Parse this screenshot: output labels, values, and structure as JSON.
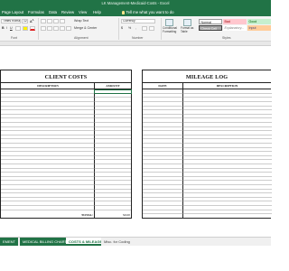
{
  "window": {
    "title": "LK Management-Medicaid-Costs  -  Excel"
  },
  "ribbon_tabs": [
    "Page Layout",
    "Formulas",
    "Data",
    "Review",
    "View",
    "Help"
  ],
  "tell_me": "Tell me what you want to do",
  "ribbon": {
    "font_name": "Times Roman",
    "font_size": "12",
    "wrap_text": "Wrap Text",
    "merge_center": "Merge & Center",
    "number_format": "Currency",
    "conditional_formatting": "Conditional Formatting",
    "format_as_table": "Format as Table",
    "groups": {
      "font": "Font",
      "alignment": "Alignment",
      "number": "Number",
      "styles": "Styles"
    },
    "styles": [
      {
        "name": "Normal",
        "bg": "#ffffff",
        "fg": "#222222"
      },
      {
        "name": "Bad",
        "bg": "#ffc7ce",
        "fg": "#9c0006"
      },
      {
        "name": "Good",
        "bg": "#c6efce",
        "fg": "#006100"
      },
      {
        "name": "Check Cell",
        "bg": "#a5a5a5",
        "fg": "#ffffff"
      },
      {
        "name": "Explanatory...",
        "bg": "#ffffff",
        "fg": "#7f7f7f"
      },
      {
        "name": "Input",
        "bg": "#ffcc99",
        "fg": "#3f3f76"
      }
    ]
  },
  "sheet": {
    "client_costs": {
      "title": "CLIENT COSTS",
      "col_description": "DESCRIPTION",
      "col_amount": "AMOUNT",
      "total_label": "TOTAL:",
      "total_value": "$0.00"
    },
    "mileage_log": {
      "title": "MILEAGE LOG",
      "col_date": "DATE",
      "col_description": "DESCRIPTION"
    }
  },
  "sheet_tabs": [
    {
      "label": "EMENT",
      "state": "green"
    },
    {
      "label": "MEDICAL BILLING CHART",
      "state": "green"
    },
    {
      "label": "COSTS & MILEAGE",
      "state": "active"
    },
    {
      "label": "Misc. for Coding",
      "state": "plain"
    }
  ],
  "colors": {
    "excel_green": "#217346",
    "ribbon_bg": "#f3f3f3",
    "grid_line": "#9a9a9a"
  }
}
